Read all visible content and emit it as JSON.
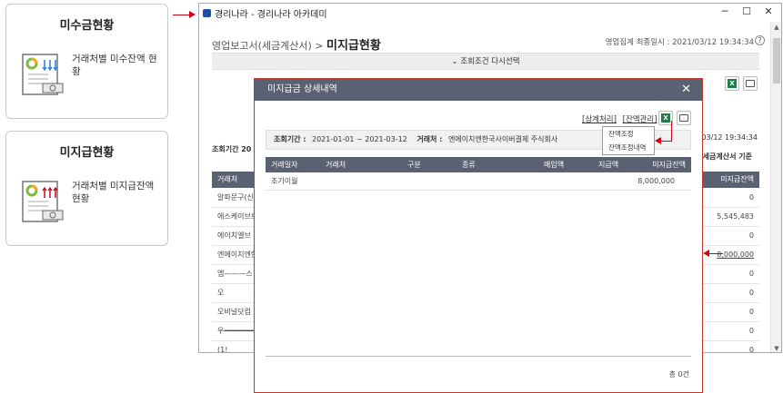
{
  "left_cards": [
    {
      "title": "미수금현황",
      "desc": "거래처별 미수잔액 현황",
      "icon": "receivable-report-icon"
    },
    {
      "title": "미지급현황",
      "desc": "거래처별 미지급잔액 현황",
      "icon": "payable-report-icon"
    }
  ],
  "window": {
    "title": "경리나라 - 경리나라 아카데미",
    "min": "─",
    "max": "☐",
    "close": "✕"
  },
  "page": {
    "breadcrumb": "영업보고서(세금계산서) >",
    "title": "미지급현황",
    "last_total_label": "영업집계 최종일시 : 2021/03/12 19:34:34",
    "help": "?",
    "reset_label": "⌄ 조회조건 다시선택"
  },
  "background": {
    "condition": "조회기간 20",
    "timestamp": "2021/03/12 19:34:34",
    "basis": "세금계산서 기준",
    "header_left": "거래처",
    "header_right": "미지급잔액",
    "rows": [
      {
        "name": "알파문구(신",
        "value": "0"
      },
      {
        "name": "에스케이브로",
        "value": "5,545,483"
      },
      {
        "name": "에이치엘브",
        "value": "0"
      },
      {
        "name": "엔에이치엔한",
        "value": "8,000,000"
      },
      {
        "name": "엠———스",
        "value": "0"
      },
      {
        "name": "오",
        "value": "0"
      },
      {
        "name": "오비널닷컴",
        "value": "0"
      },
      {
        "name": "우━━━━━━━",
        "value": "0"
      },
      {
        "name": "(1!",
        "value": "0"
      }
    ]
  },
  "modal": {
    "title": "미지급금 상세내역",
    "close": "✕",
    "link1": "[상계처리]",
    "link2": "[잔액관리]",
    "cond_period_label": "조회기간 :",
    "cond_period": "2021-01-01 ~ 2021-03-12",
    "cond_vendor_label": "거래처 :",
    "cond_vendor": "엔에이치엔한국사이버결제 주식회사",
    "columns": [
      "거래일자",
      "거래처",
      "구분",
      "종류",
      "매입액",
      "지급액",
      "미지급잔액"
    ],
    "rows": [
      {
        "date": "초기이월",
        "balance": "8,000,000"
      }
    ],
    "total": "총 0건"
  },
  "dropdown": {
    "items": [
      "잔액조정",
      "잔액조정내역"
    ]
  },
  "colors": {
    "accent_red": "#d0021b",
    "header": "#5a6173",
    "excel": "#1e7e45"
  }
}
